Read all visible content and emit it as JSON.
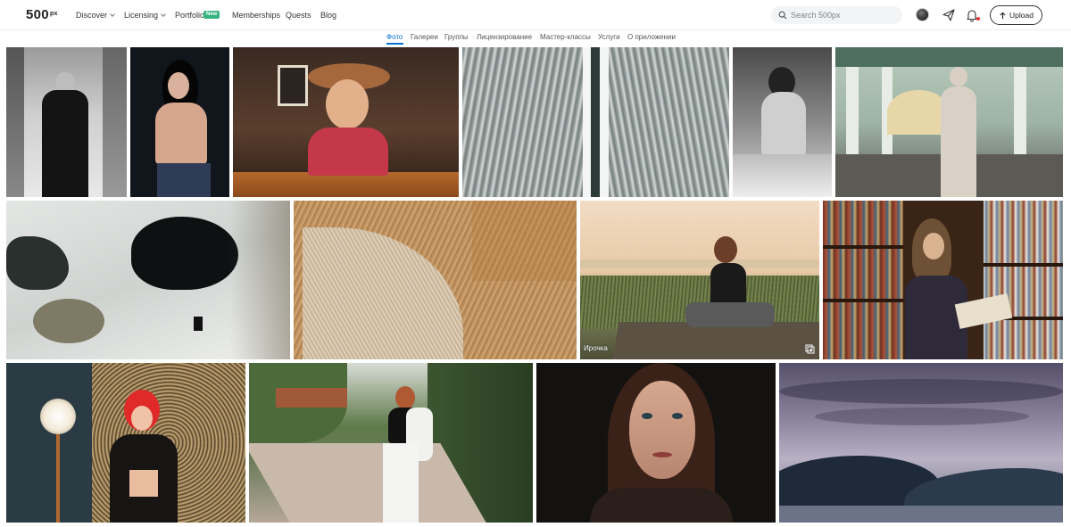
{
  "header": {
    "logo": "500",
    "logo_sup": "px",
    "nav": [
      {
        "label": "Discover",
        "dropdown": true
      },
      {
        "label": "Licensing",
        "dropdown": true
      },
      {
        "label": "Portfolio",
        "dropdown": false
      },
      {
        "label": "Memberships",
        "dropdown": false
      },
      {
        "label": "Quests",
        "dropdown": false
      },
      {
        "label": "Blog",
        "dropdown": false
      }
    ],
    "portfolio_badge": "New",
    "search_placeholder": "Search 500px",
    "upload_label": "Upload",
    "icons": [
      "search-icon",
      "avatar",
      "send-icon",
      "bell-icon",
      "upload-icon"
    ]
  },
  "subnav": {
    "tabs": [
      "Фото",
      "Галереи",
      "Группы",
      "Лицензирование",
      "Мастер-классы",
      "Услуги",
      "О приложении"
    ],
    "active_index": 0
  },
  "gallery": {
    "photos": [
      {
        "subject": "bw-woman-coat-snow"
      },
      {
        "subject": "woman-dark-hair-vest"
      },
      {
        "subject": "woman-hat-table"
      },
      {
        "subject": "aerial-snow-forest-road"
      },
      {
        "subject": "bw-woman-back"
      },
      {
        "subject": "woman-coat-arcade"
      },
      {
        "subject": "aerial-snow-person"
      },
      {
        "subject": "aerial-dry-field"
      },
      {
        "subject": "woman-boat-lake-sunset",
        "caption": "Ирочка",
        "has_gallery_icon": true
      },
      {
        "subject": "woman-reading-library"
      },
      {
        "subject": "redhead-sequin-backdrop"
      },
      {
        "subject": "woman-white-outfit-park"
      },
      {
        "subject": "portrait-dark-background"
      },
      {
        "subject": "mountains-lake-dusk"
      }
    ]
  },
  "colors": {
    "accent_blue": "#0870d1",
    "badge_green": "#36b37e",
    "notification_red": "#e53935"
  }
}
